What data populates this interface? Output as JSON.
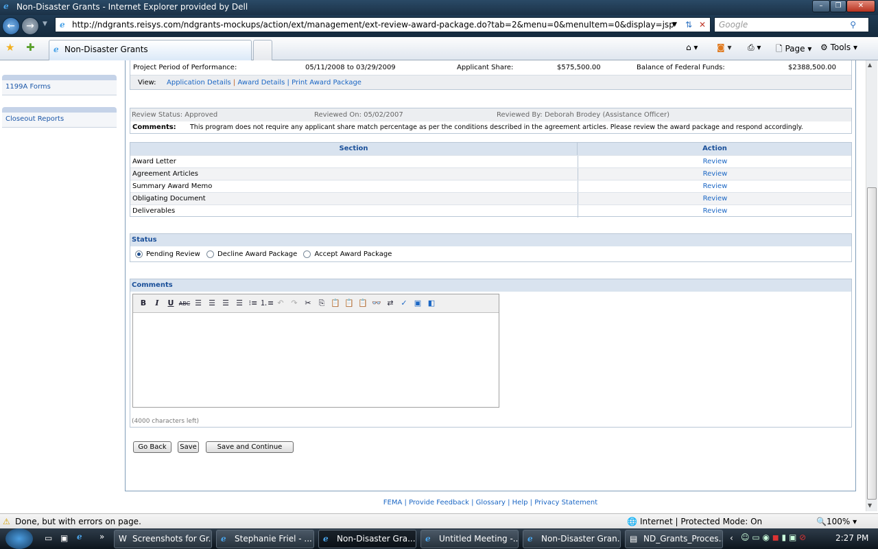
{
  "browser": {
    "title": "Non-Disaster Grants - Internet Explorer provided by Dell",
    "url": "http://ndgrants.reisys.com/ndgrants-mockups/action/ext/management/ext-review-award-package.do?tab=2&menu=0&menuItem=0&display=jsp",
    "search_placeholder": "Google",
    "tab_label": "Non-Disaster Grants",
    "page_menu": "Page",
    "tools_menu": "Tools",
    "status_text": "Done, but with errors on page.",
    "zone_text": "Internet | Protected Mode: On",
    "zoom": "100%"
  },
  "sidebar": {
    "items": [
      {
        "label": "1199A Forms"
      },
      {
        "label": "Closeout Reports"
      }
    ]
  },
  "summary": {
    "period_label": "Project Period of Performance:",
    "period_value": "05/11/2008 to 03/29/2009",
    "share_label": "Applicant Share:",
    "share_value": "$575,500.00",
    "balance_label": "Balance of Federal Funds:",
    "balance_value": "$2388,500.00",
    "view_label": "View:",
    "links": [
      "Application Details",
      "Award Details",
      "Print Award Package"
    ]
  },
  "review": {
    "status": "Review Status: Approved",
    "reviewed_on": "Reviewed On: 05/02/2007",
    "reviewed_by": "Reviewed By: Deborah Brodey (Assistance Officer)",
    "comments_label": "Comments:",
    "comments": "This program does not require any applicant share match percentage as per the conditions described in the agreement articles. Please review the award package and respond accordingly."
  },
  "sections": {
    "headers": [
      "Section",
      "Action"
    ],
    "rows": [
      {
        "name": "Award Letter",
        "action": "Review"
      },
      {
        "name": "Agreement Articles",
        "action": "Review"
      },
      {
        "name": "Summary Award Memo",
        "action": "Review"
      },
      {
        "name": "Obligating Document",
        "action": "Review"
      },
      {
        "name": "Deliverables",
        "action": "Review"
      }
    ]
  },
  "status_panel": {
    "title": "Status",
    "options": [
      {
        "label": "Pending Review",
        "selected": true
      },
      {
        "label": "Decline Award Package",
        "selected": false
      },
      {
        "label": "Accept Award Package",
        "selected": false
      }
    ]
  },
  "comments_panel": {
    "title": "Comments",
    "chars_left": "(4000 characters left)"
  },
  "buttons": {
    "go_back": "Go Back",
    "save": "Save",
    "save_continue": "Save and Continue"
  },
  "footer": {
    "links": [
      "FEMA",
      "Provide Feedback",
      "Glossary",
      "Help",
      "Privacy Statement"
    ]
  },
  "taskbar": {
    "items": [
      "Screenshots for Gr...",
      "Stephanie Friel - ...",
      "Non-Disaster Gra...",
      "Untitled Meeting -...",
      "Non-Disaster Gran...",
      "ND_Grants_Proces..."
    ],
    "clock": "2:27 PM"
  }
}
